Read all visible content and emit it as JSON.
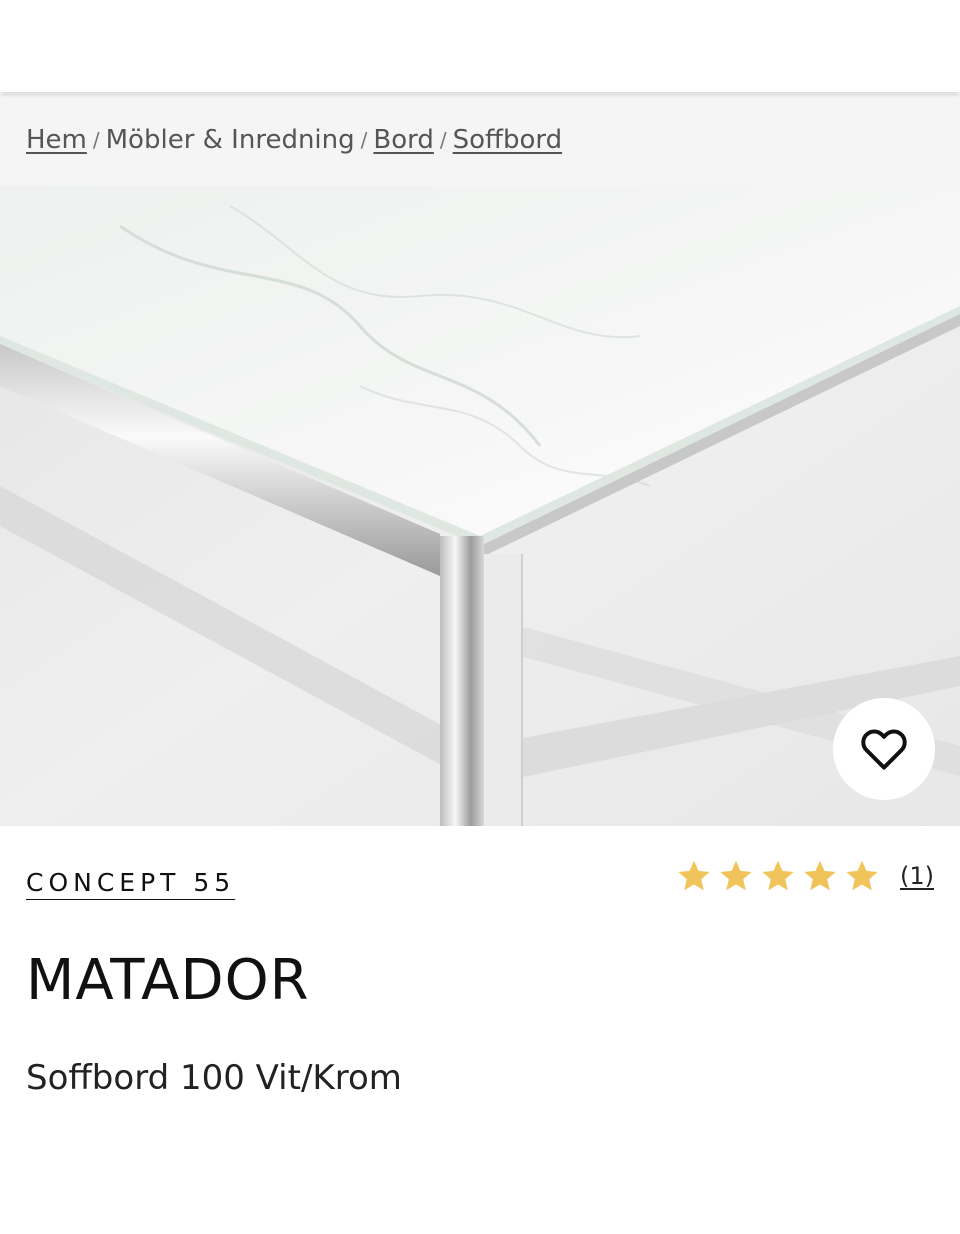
{
  "breadcrumb": {
    "items": [
      {
        "label": "Hem",
        "link": true
      },
      {
        "label": "Möbler & Inredning",
        "link": false
      },
      {
        "label": "Bord",
        "link": true
      },
      {
        "label": "Soffbord",
        "link": true
      }
    ],
    "separator": "/"
  },
  "gallery": {
    "image_icon": "marble-glass-table-photo",
    "favorite_icon": "heart-outline-icon",
    "dot_count": 5,
    "active_index": 3
  },
  "product": {
    "brand": "CONCEPT 55",
    "rating": {
      "stars": 5,
      "max": 5,
      "count_text": "(1)"
    },
    "name": "MATADOR",
    "subtitle": "Soffbord 100 Vit/Krom"
  },
  "colors": {
    "star": "#F0C45A",
    "text": "#111111",
    "breadcrumb_bg": "#F5F5F5"
  }
}
